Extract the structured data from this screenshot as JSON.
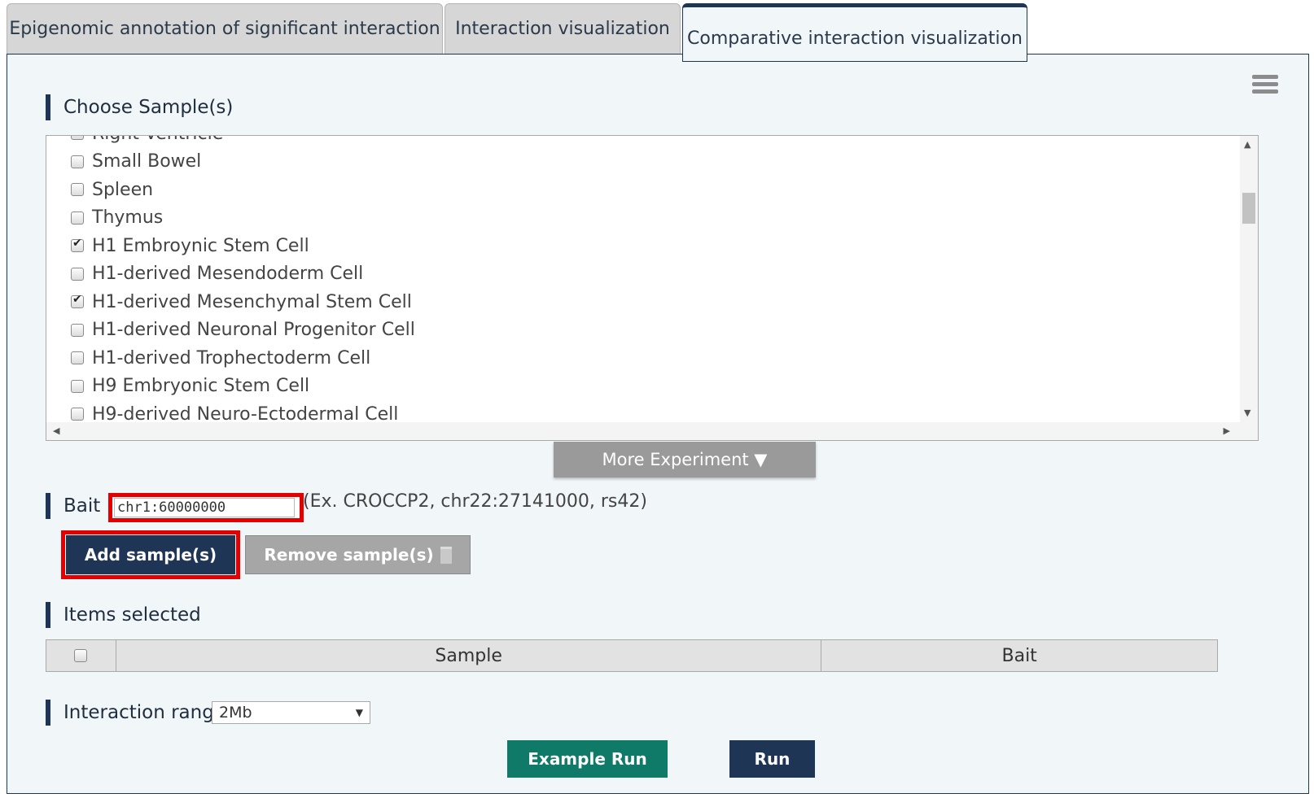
{
  "tabs": [
    {
      "label": "Epigenomic annotation of significant interaction"
    },
    {
      "label": "Interaction visualization"
    },
    {
      "label": "Comparative interaction visualization"
    }
  ],
  "choose_samples": {
    "heading": "Choose Sample(s)",
    "items": [
      {
        "label": "Right Ventricle",
        "checked": false
      },
      {
        "label": "Small Bowel",
        "checked": false
      },
      {
        "label": "Spleen",
        "checked": false
      },
      {
        "label": "Thymus",
        "checked": false
      },
      {
        "label": "H1 Embroynic Stem Cell",
        "checked": true
      },
      {
        "label": "H1-derived Mesendoderm Cell",
        "checked": false
      },
      {
        "label": "H1-derived Mesenchymal Stem Cell",
        "checked": true
      },
      {
        "label": "H1-derived Neuronal Progenitor Cell",
        "checked": false
      },
      {
        "label": "H1-derived Trophectoderm Cell",
        "checked": false
      },
      {
        "label": "H9 Embryonic Stem Cell",
        "checked": false
      },
      {
        "label": "H9-derived Neuro-Ectodermal Cell",
        "checked": false
      }
    ],
    "more_label": "More Experiment ▼"
  },
  "bait": {
    "label": "Bait :",
    "value": "chr1:60000000",
    "hint": "(Ex. CROCCP2, chr22:27141000, rs42)"
  },
  "buttons": {
    "add": "Add sample(s)",
    "remove": "Remove sample(s)",
    "example_run": "Example Run",
    "run": "Run"
  },
  "items_selected": {
    "heading": "Items selected",
    "columns": [
      "Sample",
      "Bait"
    ]
  },
  "interaction_range": {
    "label": "Interaction range",
    "selected": "2Mb"
  },
  "colors": {
    "navy": "#1f3556",
    "teal": "#0f7a68",
    "highlight": "#e40000",
    "panel_bg": "#f1f6f9"
  }
}
